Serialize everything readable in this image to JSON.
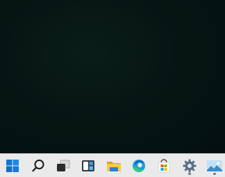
{
  "desktop": {
    "background_color": "#051411"
  },
  "taskbar": {
    "background_color": "#eaeaea",
    "items": [
      {
        "id": "start",
        "icon": "windows-start-icon",
        "running": false
      },
      {
        "id": "search",
        "icon": "search-icon",
        "running": false
      },
      {
        "id": "task-view",
        "icon": "task-view-icon",
        "running": false
      },
      {
        "id": "widgets",
        "icon": "widgets-icon",
        "running": false
      },
      {
        "id": "file-explorer",
        "icon": "folder-icon",
        "running": false
      },
      {
        "id": "edge",
        "icon": "edge-browser-icon",
        "running": false
      },
      {
        "id": "store",
        "icon": "store-bag-icon",
        "running": false
      },
      {
        "id": "settings",
        "icon": "gear-icon",
        "running": true
      },
      {
        "id": "photos",
        "icon": "photos-icon",
        "running": true
      }
    ]
  }
}
